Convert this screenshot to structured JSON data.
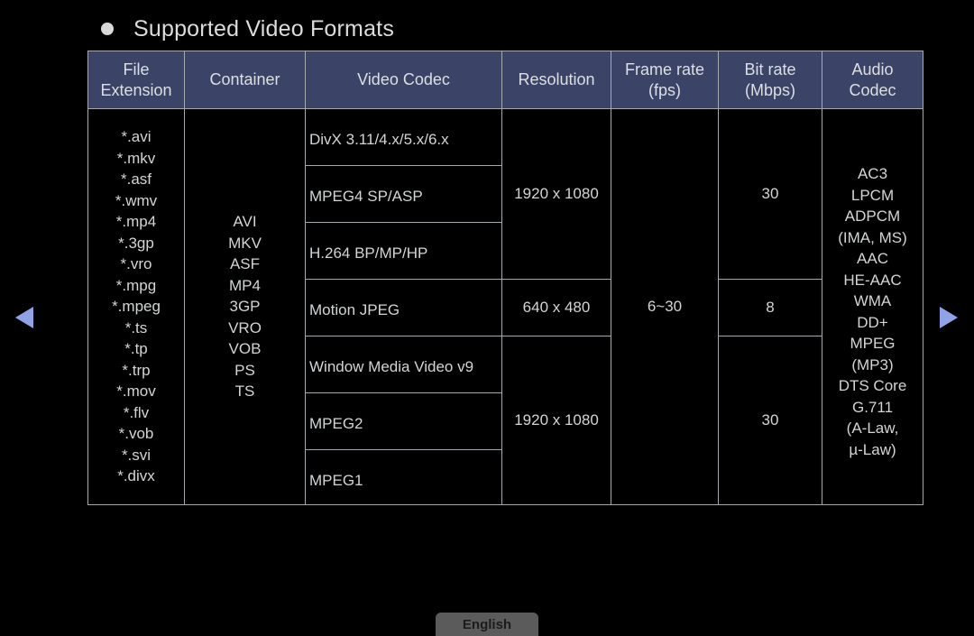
{
  "title": "Supported Video Formats",
  "nav": {
    "prev_icon": "triangle-left",
    "next_icon": "triangle-right"
  },
  "language_button": "English",
  "colors": {
    "header_bg": "#3b4466",
    "arrow": "#8fa3e6",
    "border": "#a6a9ad"
  },
  "table": {
    "headers": {
      "file_extension": [
        "File",
        "Extension"
      ],
      "container": "Container",
      "video_codec": "Video Codec",
      "resolution": "Resolution",
      "frame_rate": [
        "Frame rate",
        "(fps)"
      ],
      "bit_rate": [
        "Bit rate",
        "(Mbps)"
      ],
      "audio_codec": [
        "Audio",
        "Codec"
      ]
    },
    "file_extensions": [
      "*.avi",
      "*.mkv",
      "*.asf",
      "*.wmv",
      "*.mp4",
      "*.3gp",
      "*.vro",
      "*.mpg",
      "*.mpeg",
      "*.ts",
      "*.tp",
      "*.trp",
      "*.mov",
      "*.flv",
      "*.vob",
      "*.svi",
      "*.divx"
    ],
    "containers": [
      "AVI",
      "MKV",
      "ASF",
      "MP4",
      "3GP",
      "VRO",
      "VOB",
      "PS",
      "TS"
    ],
    "video_codecs": [
      "DivX 3.11/4.x/5.x/6.x",
      "MPEG4 SP/ASP",
      "H.264 BP/MP/HP",
      "Motion JPEG",
      "Window Media Video v9",
      "MPEG2",
      "MPEG1"
    ],
    "resolutions": [
      "1920 x 1080",
      "640 x 480",
      "1920 x 1080"
    ],
    "frame_rate": "6~30",
    "bit_rates": [
      "30",
      "8",
      "30"
    ],
    "audio_codecs": [
      "AC3",
      "LPCM",
      "ADPCM",
      "(IMA, MS)",
      "AAC",
      "HE-AAC",
      "WMA",
      "DD+",
      "MPEG",
      "(MP3)",
      "DTS Core",
      "G.711",
      "(A-Law,",
      "µ-Law)"
    ]
  }
}
